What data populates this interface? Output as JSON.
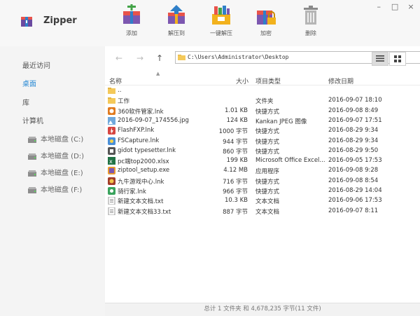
{
  "app": {
    "title": "Zipper"
  },
  "toolbar": [
    {
      "label": "添加",
      "icon": "add-archive-icon",
      "color": "#e8534a"
    },
    {
      "label": "解压到",
      "icon": "extract-to-icon",
      "color": "#2f7fc8"
    },
    {
      "label": "一键解压",
      "icon": "one-click-extract-icon",
      "color": "#f2b21d"
    },
    {
      "label": "加密",
      "icon": "encrypt-icon",
      "color": "#8a5bb5"
    },
    {
      "label": "删除",
      "icon": "delete-icon",
      "color": "#9a9a9a"
    }
  ],
  "window": {
    "minimize": "–",
    "maximize": "□",
    "close": "×"
  },
  "sidebar": {
    "recent": "最近访问",
    "desktop": "桌面",
    "library": "库",
    "computer": "计算机",
    "drives": [
      "本地磁盘 (C:)",
      "本地磁盘 (D:)",
      "本地磁盘 (E:)",
      "本地磁盘 (F:)"
    ]
  },
  "address": {
    "path": "C:\\Users\\Administrator\\Desktop"
  },
  "columns": {
    "name": "名称",
    "size": "大小",
    "type": "项目类型",
    "date": "修改日期"
  },
  "files": [
    {
      "name": "..",
      "size": "",
      "type": "",
      "date": "",
      "icon": "folder-up-icon"
    },
    {
      "name": "工作",
      "size": "",
      "type": "文件夹",
      "date": "2016-09-07 18:10",
      "icon": "folder-icon"
    },
    {
      "name": "360软件管家.lnk",
      "size": "1.01 KB",
      "type": "快捷方式",
      "date": "2016-09-08 8:49",
      "icon": "shortcut-360-icon"
    },
    {
      "name": "2016-09-07_174556.jpg",
      "size": "124 KB",
      "type": "Kankan JPEG 图像",
      "date": "2016-09-07 17:51",
      "icon": "image-file-icon"
    },
    {
      "name": "FlashFXP.lnk",
      "size": "1000 字节",
      "type": "快捷方式",
      "date": "2016-08-29 9:34",
      "icon": "flashfxp-icon"
    },
    {
      "name": "FSCapture.lnk",
      "size": "944 字节",
      "type": "快捷方式",
      "date": "2016-08-29 9:34",
      "icon": "fscapture-icon"
    },
    {
      "name": "gidot typesetter.lnk",
      "size": "860 字节",
      "type": "快捷方式",
      "date": "2016-08-29 9:50",
      "icon": "typesetter-icon"
    },
    {
      "name": "pc端top2000.xlsx",
      "size": "199 KB",
      "type": "Microsoft Office Excel...",
      "date": "2016-09-05 17:53",
      "icon": "excel-file-icon"
    },
    {
      "name": "ziptool_setup.exe",
      "size": "4.12 MB",
      "type": "应用程序",
      "date": "2016-09-08 9:28",
      "icon": "installer-icon"
    },
    {
      "name": "九牛游戏中心.lnk",
      "size": "716 字节",
      "type": "快捷方式",
      "date": "2016-09-08 8:54",
      "icon": "game-center-icon"
    },
    {
      "name": "骑行家.lnk",
      "size": "966 字节",
      "type": "快捷方式",
      "date": "2016-08-29 14:04",
      "icon": "app-shortcut-icon"
    },
    {
      "name": "新建文本文档.txt",
      "size": "10.3 KB",
      "type": "文本文档",
      "date": "2016-09-06 17:53",
      "icon": "text-file-icon"
    },
    {
      "name": "新建文本文档33.txt",
      "size": "887 字节",
      "type": "文本文档",
      "date": "2016-09-07 8:11",
      "icon": "text-file-icon"
    }
  ],
  "status": "总计 1 文件夹 和 4,678,235 字节(11 文件)"
}
